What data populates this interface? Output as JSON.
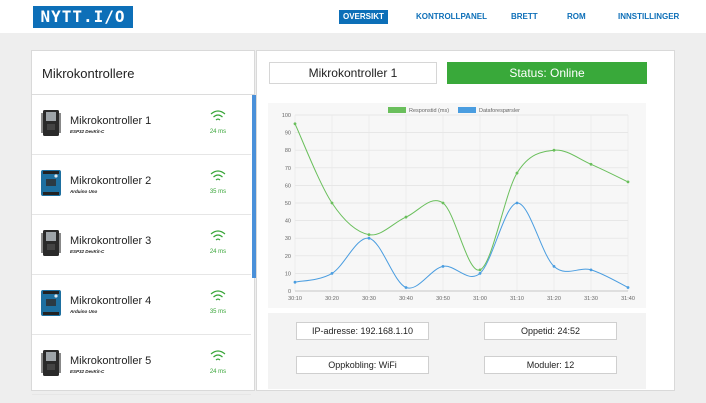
{
  "header": {
    "logo": "NYTT.I/O",
    "nav": [
      "OVERSIKT",
      "KONTROLLPANEL",
      "BRETT",
      "ROM",
      "INNSTILLINGER"
    ],
    "active_nav": "OVERSIKT"
  },
  "sidebar": {
    "title": "Mikrokontrollere",
    "items": [
      {
        "name": "Mikrokontroller 1",
        "model": "ESP32 DevKit-C",
        "latency": "24 ms",
        "board_icon": "esp32-board-icon"
      },
      {
        "name": "Mikrokontroller 2",
        "model": "Arduino Uno",
        "latency": "35 ms",
        "board_icon": "arduino-board-icon"
      },
      {
        "name": "Mikrokontroller 3",
        "model": "ESP32 DevKit-C",
        "latency": "24 ms",
        "board_icon": "esp32-board-icon"
      },
      {
        "name": "Mikrokontroller 4",
        "model": "Arduino Uno",
        "latency": "35 ms",
        "board_icon": "arduino-board-icon"
      },
      {
        "name": "Mikrokontroller 5",
        "model": "ESP32 DevKit-C",
        "latency": "24 ms",
        "board_icon": "esp32-board-icon"
      }
    ]
  },
  "main": {
    "controller_name": "Mikrokontroller 1",
    "status": "Status: Online",
    "info": {
      "ip": "IP-adresse: 192.168.1.10",
      "uptime": "Oppetid: 24:52",
      "connection": "Oppkobling: WiFi",
      "modules": "Moduler: 12"
    }
  },
  "colors": {
    "accent": "#0d6fb8",
    "online": "#39a93a",
    "series_response": "#6abf5c",
    "series_data": "#4a9de0"
  },
  "chart_data": {
    "type": "line",
    "x": [
      "30:10",
      "30:20",
      "30:30",
      "30:40",
      "30:50",
      "31:00",
      "31:10",
      "31:20",
      "31:30",
      "31:40"
    ],
    "series": [
      {
        "name": "Responstid (ms)",
        "values": [
          95,
          50,
          32,
          42,
          50,
          12,
          67,
          80,
          72,
          62
        ]
      },
      {
        "name": "Dataforespørsler",
        "values": [
          5,
          10,
          30,
          2,
          14,
          10,
          50,
          14,
          12,
          2
        ]
      }
    ],
    "ylim": [
      0,
      100
    ],
    "yticks": [
      0,
      10,
      20,
      30,
      40,
      50,
      60,
      70,
      80,
      90,
      100
    ],
    "grid": true,
    "legend": "top"
  }
}
